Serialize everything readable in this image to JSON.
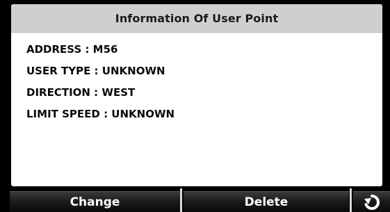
{
  "panel": {
    "title": "Information Of User Point",
    "rows": [
      {
        "label": "ADDRESS : M56"
      },
      {
        "label": "USER TYPE : UNKNOWN"
      },
      {
        "label": "DIRECTION : WEST"
      },
      {
        "label": "LIMIT SPEED : UNKNOWN"
      }
    ]
  },
  "softkeys": {
    "change_label": "Change",
    "delete_label": "Delete",
    "back_icon": "back-arrow-icon"
  },
  "colors": {
    "background": "#000000",
    "panel_background": "#ffffff",
    "header_background": "#cfcfcf",
    "softkey_background": "#1c1c1c",
    "softkey_text": "#ffffff"
  }
}
